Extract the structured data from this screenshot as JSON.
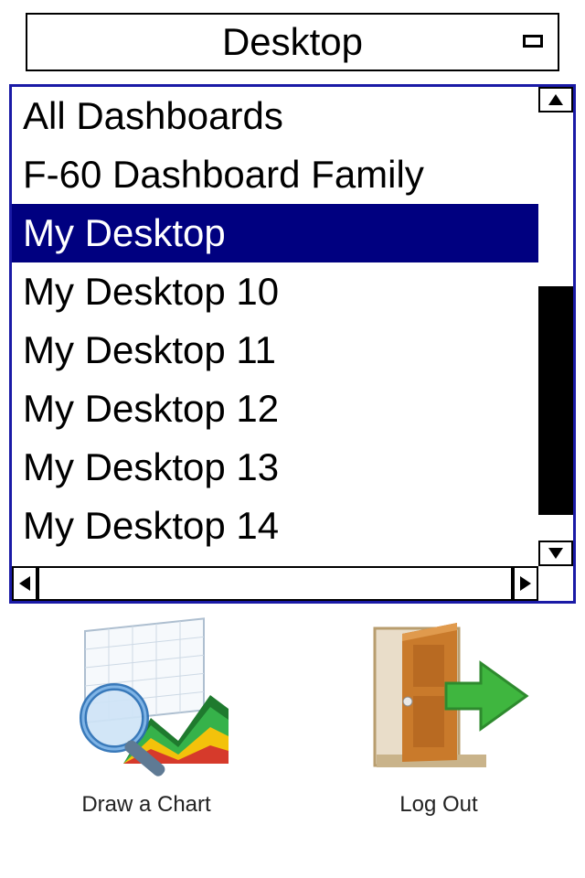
{
  "title": "Desktop",
  "dropdown": {
    "selected_index": 2,
    "items": [
      "All Dashboards",
      "F-60 Dashboard Family",
      "My Desktop",
      "My Desktop 10",
      "My Desktop 11",
      "My Desktop 12",
      "My Desktop 13",
      "My Desktop 14"
    ]
  },
  "actions": {
    "draw_chart": "Draw a Chart",
    "log_out": "Log Out"
  },
  "icons": {
    "chart": "chart-magnifier-icon",
    "logout": "door-exit-icon"
  },
  "colors": {
    "selection": "#000080",
    "border": "#1a1aa6"
  }
}
